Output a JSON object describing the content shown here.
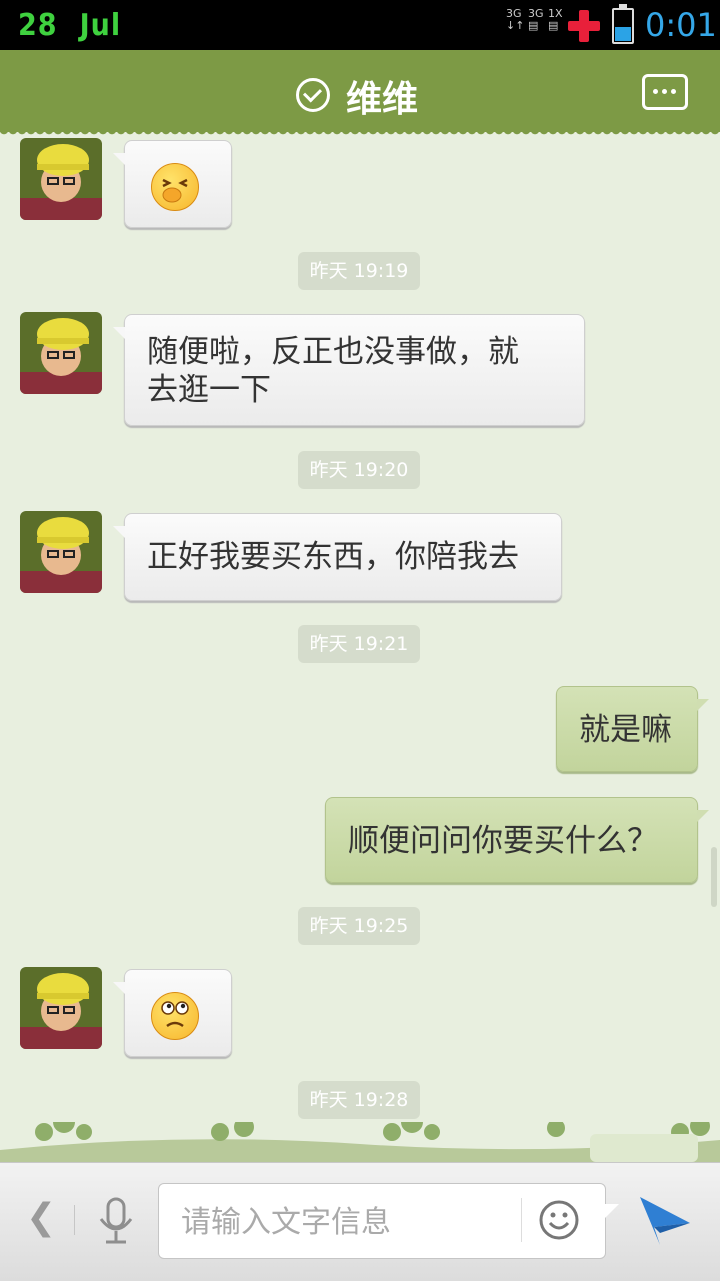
{
  "status_bar": {
    "day": "28",
    "month": "Jul",
    "signal_1": "3G",
    "signal_2": "3G",
    "signal_3": "1X",
    "time": "0:01",
    "battery_level": 0.45,
    "icons": [
      "signal-icon",
      "alert-plus-icon",
      "battery-icon"
    ]
  },
  "header": {
    "title": "维维",
    "online_icon": "check-circle-icon",
    "menu_icon": "more-options-icon",
    "accent_color": "#7d9a45"
  },
  "messages": [
    {
      "side": "in",
      "type": "emoji",
      "emoji": "face-covering-mouth-emoji"
    },
    {
      "type": "timestamp",
      "text": "昨天 19:19"
    },
    {
      "side": "in",
      "type": "text",
      "text_line1": "随便啦，反正也没事做，就",
      "text_line2": "去逛一下"
    },
    {
      "type": "timestamp",
      "text": "昨天 19:20"
    },
    {
      "side": "in",
      "type": "text",
      "text": "正好我要买东西，你陪我去"
    },
    {
      "type": "timestamp",
      "text": "昨天 19:21"
    },
    {
      "side": "out",
      "type": "text",
      "text": "就是嘛"
    },
    {
      "side": "out",
      "type": "text",
      "text": "顺便问问你要买什么？"
    },
    {
      "type": "timestamp",
      "text": "昨天 19:25"
    },
    {
      "side": "in",
      "type": "emoji",
      "emoji": "confused-face-emoji"
    },
    {
      "type": "timestamp",
      "text": "昨天 19:28"
    }
  ],
  "input_bar": {
    "back_icon": "chevron-left-icon",
    "voice_icon": "microphone-icon",
    "placeholder": "请输入文字信息",
    "emoji_icon": "smiley-icon",
    "send_icon": "paper-plane-icon",
    "send_color": "#2f7fd3"
  }
}
